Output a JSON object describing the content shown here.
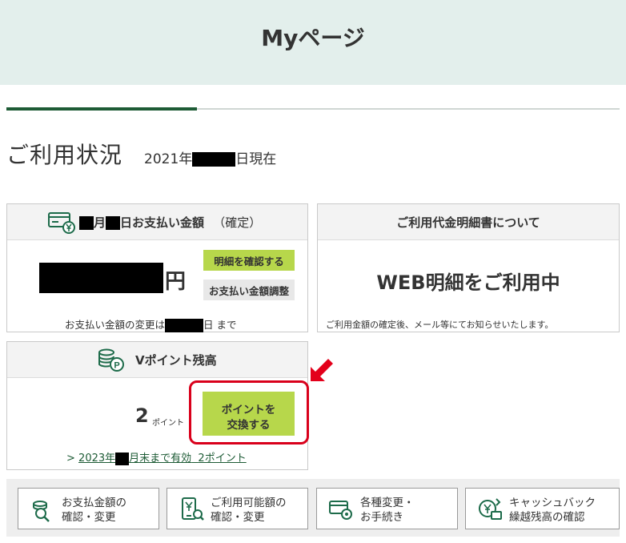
{
  "header": {
    "title": "Myページ"
  },
  "usage": {
    "heading": "ご利用状況",
    "as_of_prefix": "2021年",
    "as_of_suffix": "日現在"
  },
  "payment_card": {
    "title_part_month": "月",
    "title_part_day": "日お支払い金額",
    "title_status": "（確定）",
    "amount_suffix": "円",
    "details_button": "明細を確認する",
    "adjust_button": "お支払い金額調整",
    "change_note_prefix": "お支払い金額の変更は",
    "change_note_suffix": "日 まで"
  },
  "bill_card": {
    "title": "ご利用代金明細書について",
    "status": "WEB明細をご利用中",
    "note": "ご利用金額の確定後、メール等にてお知らせいたします。"
  },
  "points_card": {
    "title": "Vポイント残高",
    "balance": "2",
    "unit": "ポイント",
    "exchange_button_line1": "ポイントを",
    "exchange_button_line2": "交換する",
    "expire_arrow": ">",
    "expire_prefix": "2023年",
    "expire_suffix": "月末まで有効",
    "expire_points": "2ポイント"
  },
  "bottom_nav": [
    {
      "label": "お支払金額の\n確認・変更",
      "icon": "coin-search-icon"
    },
    {
      "label": "ご利用可能額の\n確認・変更",
      "icon": "phone-yen-icon"
    },
    {
      "label": "各種変更・\nお手続き",
      "icon": "card-gear-icon"
    },
    {
      "label": "キャッシュバック\n繰越残高の確認",
      "icon": "cashback-icon"
    }
  ],
  "colors": {
    "header_bg": "#e3efec",
    "accent_dark_green": "#1d5b35",
    "button_green": "#b7d74b",
    "highlight_red": "#d9001b"
  }
}
